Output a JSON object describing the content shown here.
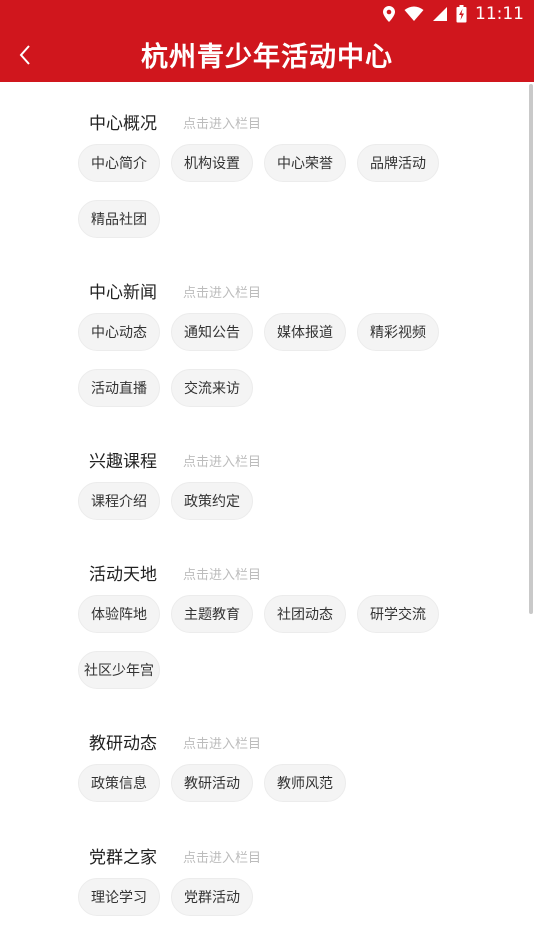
{
  "status": {
    "time": "11:11"
  },
  "header": {
    "title": "杭州青少年活动中心",
    "back_icon": "chevron-left-icon"
  },
  "sections": [
    {
      "title": "中心概况",
      "hint": "点击进入栏目",
      "items": [
        "中心简介",
        "机构设置",
        "中心荣誉",
        "品牌活动",
        "精品社团"
      ]
    },
    {
      "title": "中心新闻",
      "hint": "点击进入栏目",
      "items": [
        "中心动态",
        "通知公告",
        "媒体报道",
        "精彩视频",
        "活动直播",
        "交流来访"
      ]
    },
    {
      "title": "兴趣课程",
      "hint": "点击进入栏目",
      "items": [
        "课程介绍",
        "政策约定"
      ]
    },
    {
      "title": "活动天地",
      "hint": "点击进入栏目",
      "items": [
        "体验阵地",
        "主题教育",
        "社团动态",
        "研学交流",
        "社区少年宫"
      ]
    },
    {
      "title": "教研动态",
      "hint": "点击进入栏目",
      "items": [
        "政策信息",
        "教研活动",
        "教师风范"
      ]
    },
    {
      "title": "党群之家",
      "hint": "点击进入栏目",
      "items": [
        "理论学习",
        "党群活动"
      ]
    }
  ],
  "colors": {
    "brand": "#d0161d",
    "chip_bg": "#f4f4f4",
    "hint": "#bcbcbc"
  }
}
